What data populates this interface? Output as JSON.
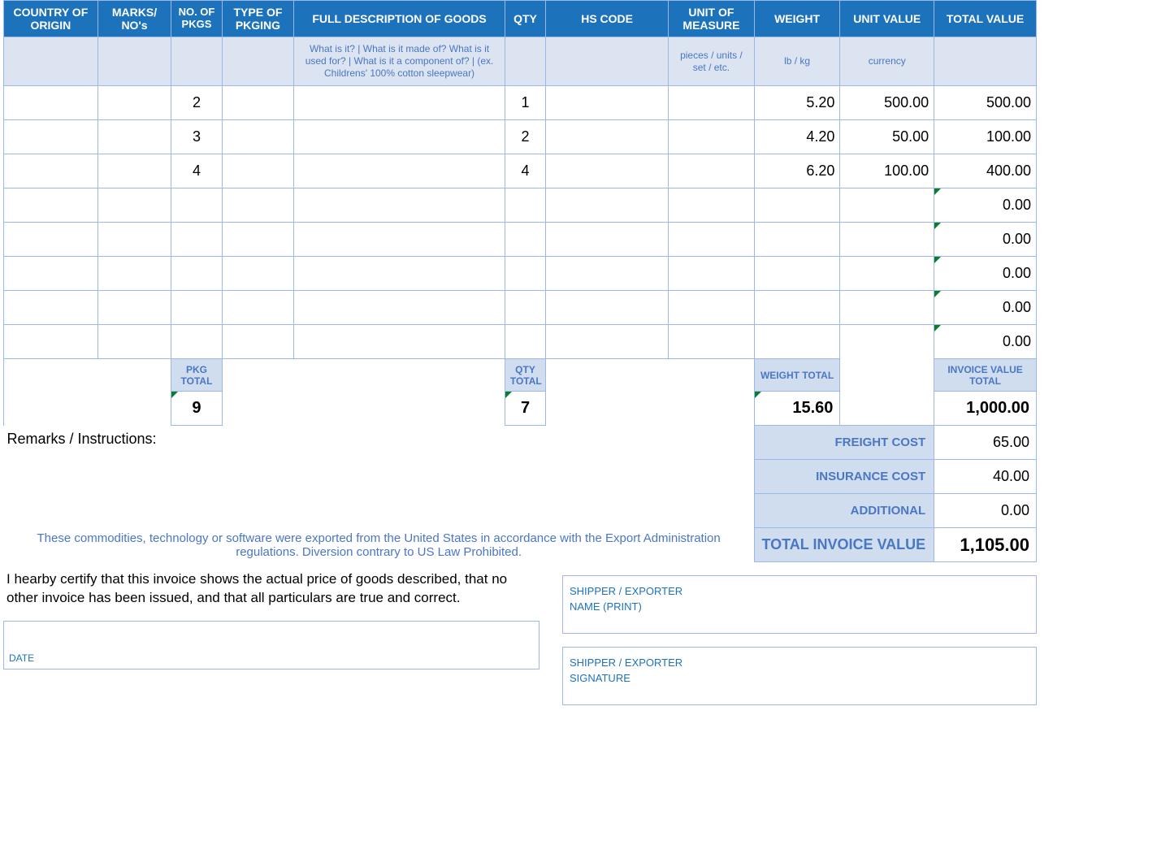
{
  "headers": {
    "country": "COUNTRY OF ORIGIN",
    "marks": "MARKS/ NO's",
    "pkgs": "NO. OF PKGS",
    "pktype": "TYPE OF PKGING",
    "desc": "FULL DESCRIPTION OF GOODS",
    "qty": "QTY",
    "hs": "HS CODE",
    "uom": "UNIT OF MEASURE",
    "weight": "WEIGHT",
    "uval": "UNIT VALUE",
    "tval": "TOTAL VALUE"
  },
  "hints": {
    "desc": "What is it? | What is it made of? What is it used for? | What is it a component of? | (ex. Childrens' 100% cotton sleepwear)",
    "uom": "pieces / units / set / etc.",
    "weight": "lb / kg",
    "uval": "currency"
  },
  "rows": [
    {
      "pkgs": "2",
      "qty": "1",
      "weight": "5.20",
      "uval": "500.00",
      "tval": "500.00"
    },
    {
      "pkgs": "3",
      "qty": "2",
      "weight": "4.20",
      "uval": "50.00",
      "tval": "100.00"
    },
    {
      "pkgs": "4",
      "qty": "4",
      "weight": "6.20",
      "uval": "100.00",
      "tval": "400.00"
    },
    {
      "tval": "0.00"
    },
    {
      "tval": "0.00"
    },
    {
      "tval": "0.00"
    },
    {
      "tval": "0.00"
    },
    {
      "tval": "0.00"
    }
  ],
  "totals": {
    "pkg_label": "PKG TOTAL",
    "qty_label": "QTY TOTAL",
    "weight_label": "WEIGHT TOTAL",
    "inv_label": "INVOICE VALUE TOTAL",
    "pkg": "9",
    "qty": "7",
    "weight": "15.60",
    "invoice": "1,000.00"
  },
  "summary": {
    "freight_lbl": "FREIGHT COST",
    "freight": "65.00",
    "ins_lbl": "INSURANCE COST",
    "ins": "40.00",
    "add_lbl": "ADDITIONAL",
    "add": "0.00",
    "total_lbl": "TOTAL INVOICE VALUE",
    "total": "1,105.00"
  },
  "labels": {
    "remarks": "Remarks / Instructions:",
    "export_note": "These commodities, technology or software were exported from the United States in accordance with the Export Administration regulations.  Diversion contrary to US Law Prohibited.",
    "certify": "I hearby certify that this invoice shows the actual price of goods described, that no other invoice has been issued, and that all particulars are true and correct.",
    "date": "DATE",
    "shipper_name": "SHIPPER / EXPORTER\nNAME (PRINT)",
    "shipper_sig": "SHIPPER / EXPORTER\nSIGNATURE"
  }
}
